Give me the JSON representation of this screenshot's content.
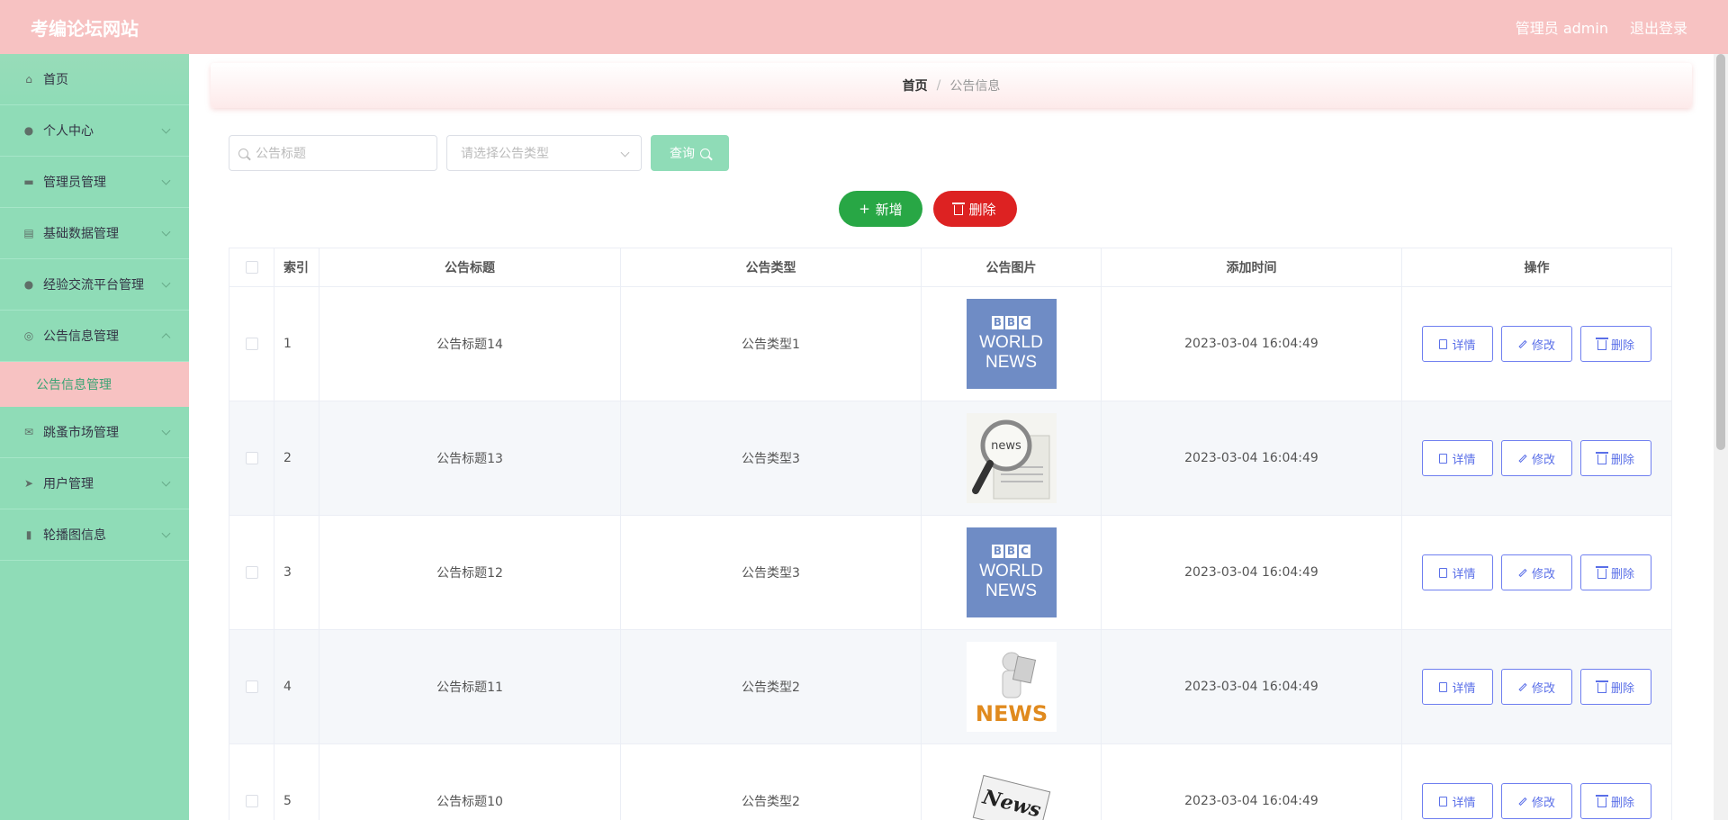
{
  "app": {
    "title": "考编论坛网站"
  },
  "header": {
    "admin_label": "管理员 admin",
    "logout_label": "退出登录"
  },
  "sidebar": {
    "items": [
      {
        "label": "首页",
        "icon": "home-icon"
      },
      {
        "label": "个人中心",
        "icon": "user-icon"
      },
      {
        "label": "管理员管理",
        "icon": "ticket-icon"
      },
      {
        "label": "基础数据管理",
        "icon": "monitor-icon"
      },
      {
        "label": "经验交流平台管理",
        "icon": "location-icon"
      },
      {
        "label": "公告信息管理",
        "icon": "compass-icon"
      },
      {
        "label": "跳蚤市场管理",
        "icon": "mail-icon"
      },
      {
        "label": "用户管理",
        "icon": "send-icon"
      },
      {
        "label": "轮播图信息",
        "icon": "notebook-icon"
      }
    ],
    "active_sub": "公告信息管理"
  },
  "breadcrumb": {
    "home": "首页",
    "separator": "/",
    "current": "公告信息"
  },
  "search": {
    "title_placeholder": "公告标题",
    "type_placeholder": "请选择公告类型",
    "query_label": "查询"
  },
  "actions": {
    "add_label": "新增",
    "delete_label": "删除"
  },
  "table": {
    "headers": {
      "index": "索引",
      "title": "公告标题",
      "type": "公告类型",
      "image": "公告图片",
      "time": "添加时间",
      "ops": "操作"
    },
    "op_labels": {
      "detail": "详情",
      "edit": "修改",
      "delete": "删除"
    },
    "rows": [
      {
        "index": "1",
        "title": "公告标题14",
        "type": "公告类型1",
        "image": "bbc-world-news",
        "time": "2023-03-04 16:04:49"
      },
      {
        "index": "2",
        "title": "公告标题13",
        "type": "公告类型3",
        "image": "magnifier-news",
        "time": "2023-03-04 16:04:49"
      },
      {
        "index": "3",
        "title": "公告标题12",
        "type": "公告类型3",
        "image": "bbc-world-news",
        "time": "2023-03-04 16:04:49"
      },
      {
        "index": "4",
        "title": "公告标题11",
        "type": "公告类型2",
        "image": "news-figure",
        "time": "2023-03-04 16:04:49"
      },
      {
        "index": "5",
        "title": "公告标题10",
        "type": "公告类型2",
        "image": "newspaper-news",
        "time": "2023-03-04 16:04:49"
      }
    ]
  },
  "thumb_text": {
    "bbc": [
      "B",
      "B",
      "C"
    ],
    "world": "WORLD",
    "news": "NEWS",
    "mag": "news",
    "figure": "NEWS",
    "paper": "News"
  },
  "colors": {
    "header_bg": "#f7c2c2",
    "sidebar_bg": "#8fdcb7",
    "add_button": "#28a745",
    "delete_button": "#dd2222",
    "op_button": "#5a6fe8"
  }
}
